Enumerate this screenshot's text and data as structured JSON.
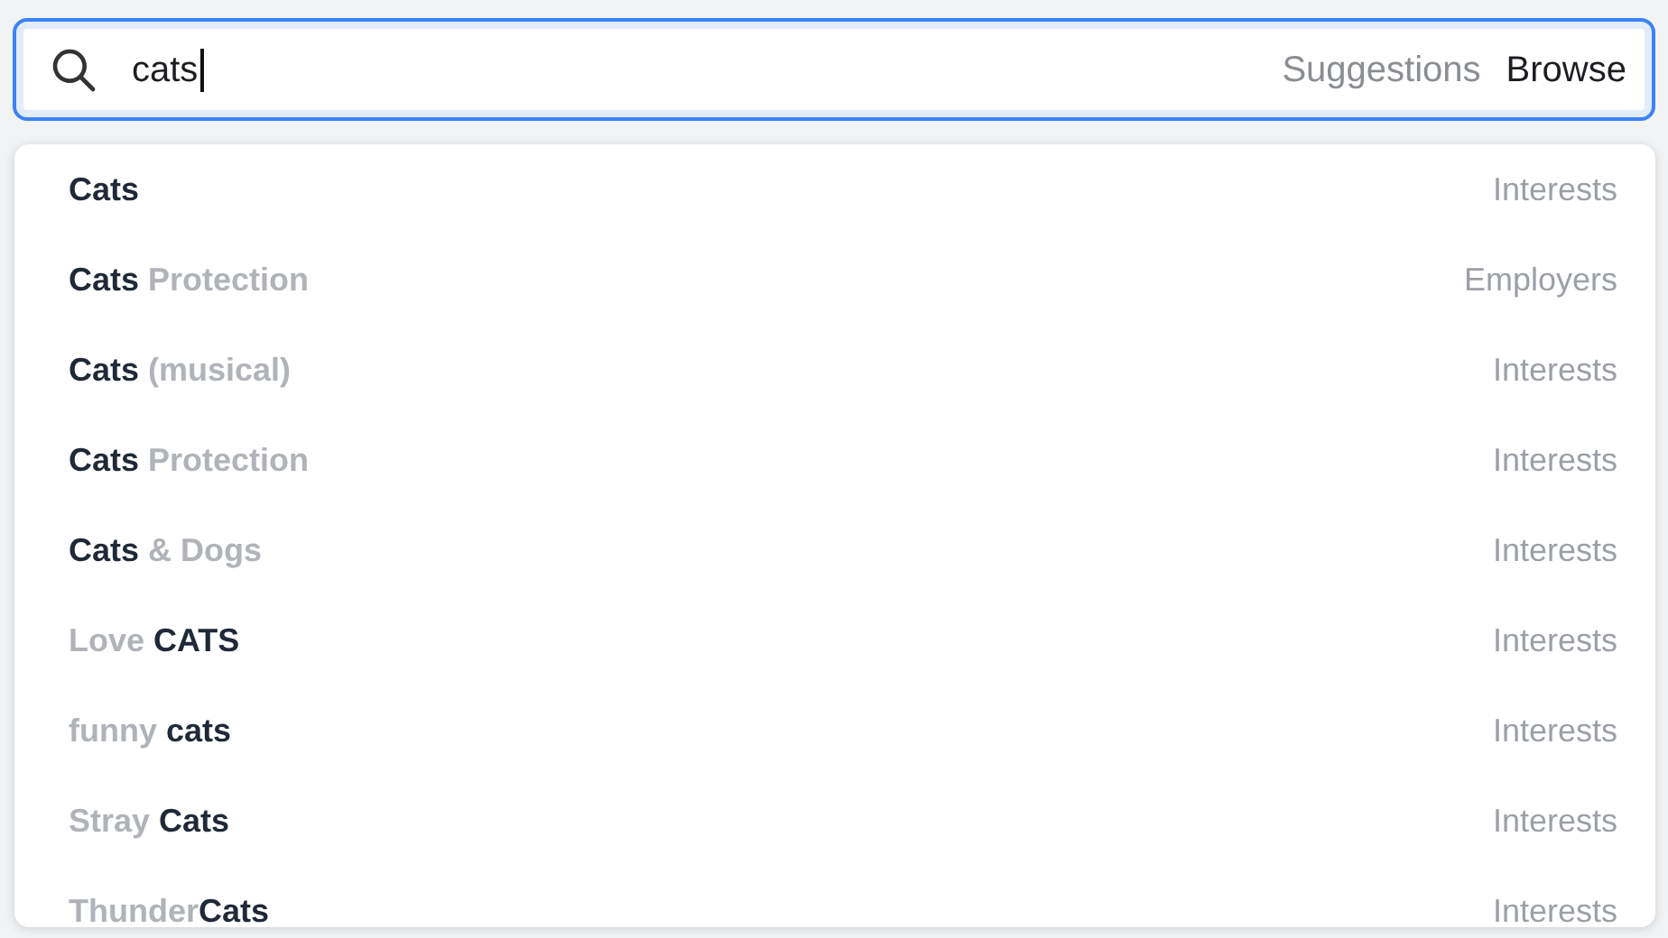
{
  "search": {
    "value": "cats",
    "tabs": [
      {
        "label": "Suggestions",
        "selected": false
      },
      {
        "label": "Browse",
        "selected": true
      }
    ]
  },
  "suggestions": [
    {
      "segments": [
        {
          "text": "Cats",
          "match": true
        }
      ],
      "category": "Interests"
    },
    {
      "segments": [
        {
          "text": "Cats",
          "match": true
        },
        {
          "text": " Protection",
          "match": false
        }
      ],
      "category": "Employers"
    },
    {
      "segments": [
        {
          "text": "Cats",
          "match": true
        },
        {
          "text": " (musical)",
          "match": false
        }
      ],
      "category": "Interests"
    },
    {
      "segments": [
        {
          "text": "Cats",
          "match": true
        },
        {
          "text": " Protection",
          "match": false
        }
      ],
      "category": "Interests"
    },
    {
      "segments": [
        {
          "text": "Cats",
          "match": true
        },
        {
          "text": " & Dogs",
          "match": false
        }
      ],
      "category": "Interests"
    },
    {
      "segments": [
        {
          "text": "Love ",
          "match": false
        },
        {
          "text": "CATS",
          "match": true
        }
      ],
      "category": "Interests"
    },
    {
      "segments": [
        {
          "text": "funny ",
          "match": false
        },
        {
          "text": "cats",
          "match": true
        }
      ],
      "category": "Interests"
    },
    {
      "segments": [
        {
          "text": "Stray ",
          "match": false
        },
        {
          "text": "Cats",
          "match": true
        }
      ],
      "category": "Interests"
    },
    {
      "segments": [
        {
          "text": "Thunder",
          "match": false
        },
        {
          "text": "Cats",
          "match": true
        }
      ],
      "category": "Interests"
    }
  ]
}
